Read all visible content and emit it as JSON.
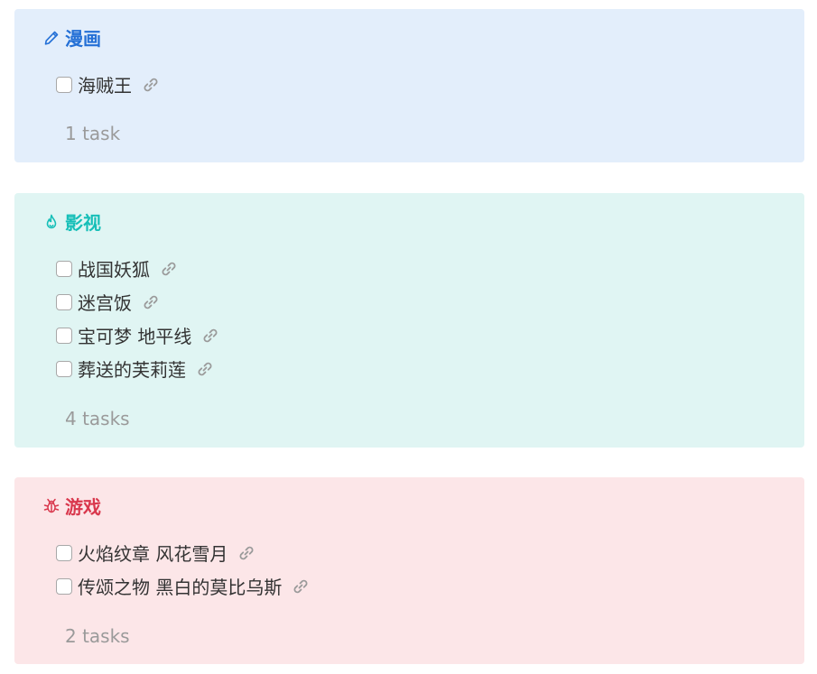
{
  "groups": [
    {
      "title": "漫画",
      "icon": "pencil-icon",
      "color": "#2470d6",
      "background": "#e3eefb",
      "tasks": [
        {
          "label": "海贼王",
          "icon": "link-icon"
        }
      ],
      "count_label": "1 task"
    },
    {
      "title": "影视",
      "icon": "flame-icon",
      "color": "#17bfb8",
      "background": "#e0f5f3",
      "tasks": [
        {
          "label": "战国妖狐",
          "icon": "link-icon"
        },
        {
          "label": "迷宫饭",
          "icon": "link-icon"
        },
        {
          "label": "宝可梦 地平线",
          "icon": "link-icon"
        },
        {
          "label": "葬送的芙莉莲",
          "icon": "link-icon"
        }
      ],
      "count_label": "4 tasks"
    },
    {
      "title": "游戏",
      "icon": "bug-icon",
      "color": "#d9384d",
      "background": "#fce6e8",
      "tasks": [
        {
          "label": "火焰纹章 风花雪月",
          "icon": "link-icon"
        },
        {
          "label": "传颂之物 黑白的莫比乌斯",
          "icon": "link-icon"
        }
      ],
      "count_label": "2 tasks"
    }
  ]
}
